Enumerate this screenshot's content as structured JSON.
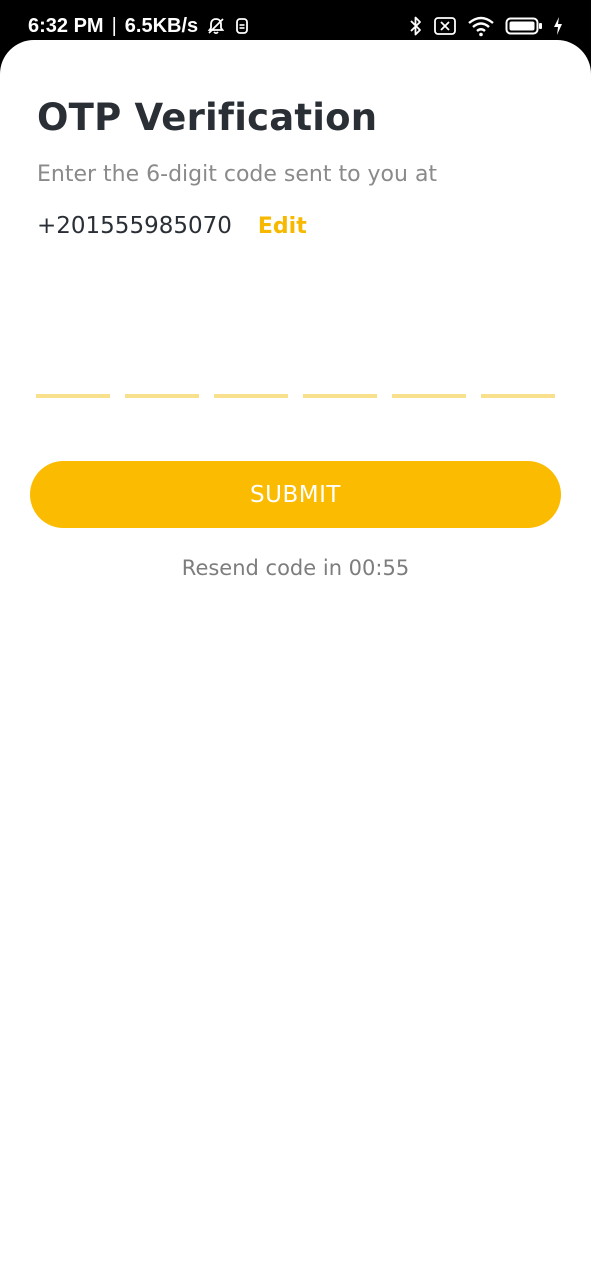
{
  "status_bar": {
    "time": "6:32 PM",
    "separator": "|",
    "network_speed": "6.5KB/s",
    "icons": [
      "bell-off-icon",
      "sim-icon",
      "bluetooth-icon",
      "no-sim-icon",
      "wifi-icon",
      "battery-icon",
      "charging-icon"
    ]
  },
  "screen": {
    "title": "OTP Verification",
    "subtitle": "Enter the 6-digit code sent to you at",
    "phone_number": "+201555985070",
    "edit_label": "Edit"
  },
  "otp": {
    "digits": [
      "",
      "",
      "",
      "",
      "",
      ""
    ]
  },
  "submit_label": "SUBMIT",
  "resend_text": "Resend code in 00:55",
  "colors": {
    "accent": "#fbbb00",
    "otp_underline": "#f9e08c",
    "title": "#2a2f36",
    "muted": "#8a8a8a"
  }
}
